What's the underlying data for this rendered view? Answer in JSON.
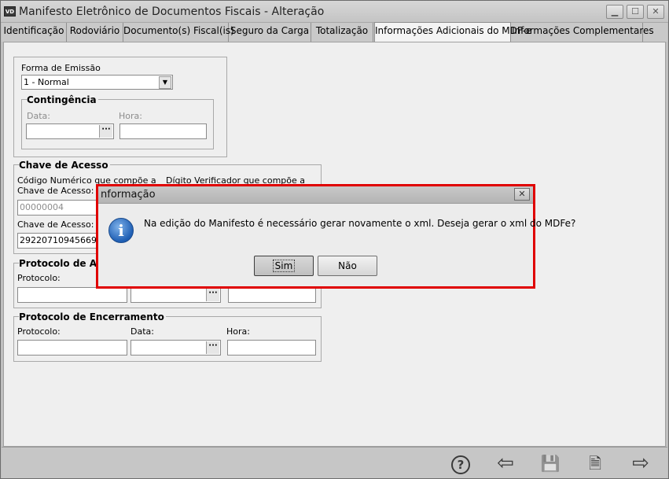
{
  "window": {
    "icon_text": "VD",
    "title": "Manifesto Eletrônico de Documentos Fiscais - Alteração",
    "minimize": "▁",
    "maximize": "☐",
    "close": "✕"
  },
  "tabs": [
    {
      "label": "Identificação"
    },
    {
      "label": "Rodoviário"
    },
    {
      "label": "Documento(s) Fiscal(is)"
    },
    {
      "label": "Seguro da Carga"
    },
    {
      "label": "Totalização"
    },
    {
      "label": "Informações Adicionais do MDF-e"
    },
    {
      "label": "Informações Complementares"
    }
  ],
  "active_tab": "Informações Adicionais do MDF-e",
  "form": {
    "forma_emissao": {
      "label": "Forma de Emissão",
      "value": "1 - Normal"
    },
    "contingencia": {
      "title": "Contingência",
      "data_label": "Data:",
      "hora_label": "Hora:",
      "data_value": "",
      "hora_value": ""
    },
    "chave_acesso": {
      "title": "Chave de Acesso",
      "codigo_label_line1": "Código Numérico que compõe a",
      "codigo_label_line2": "Chave de Acesso:",
      "digito_label": "Dígito Verificador que compõe a",
      "codigo_value": "00000004",
      "chave_label": "Chave de Acesso:",
      "chave_value": "2922071094566900"
    },
    "protocolo_autorizacao": {
      "title": "Protocolo de Aut",
      "protocolo_label": "Protocolo:",
      "protocolo_value": "",
      "data_value": "",
      "hora_value": ""
    },
    "protocolo_encerramento": {
      "title": "Protocolo de Encerramento",
      "protocolo_label": "Protocolo:",
      "data_label": "Data:",
      "hora_label": "Hora:",
      "protocolo_value": "",
      "data_value": "",
      "hora_value": ""
    }
  },
  "dialog": {
    "title": "nformação",
    "message": "Na edição do Manifesto é necessário gerar novamente o xml. Deseja gerar o xml do MDFe?",
    "yes_button": "Sim",
    "no_button": "Não",
    "close": "✕",
    "icon": "info-icon"
  },
  "toolbar": {
    "help_icon": "?",
    "back_icon": "⇦",
    "save_icon": "💾",
    "cancel_icon": "🗎",
    "forward_icon": "⇨"
  },
  "colors": {
    "dialog_border": "#e00000",
    "info_icon": "#1e5eb3"
  }
}
